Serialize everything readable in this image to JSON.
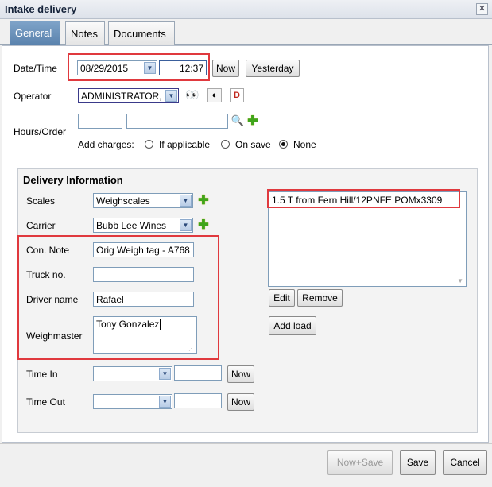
{
  "window": {
    "title": "Intake delivery"
  },
  "tabs": [
    {
      "label": "General"
    },
    {
      "label": "Notes"
    },
    {
      "label": "Documents"
    }
  ],
  "general": {
    "datetime_label": "Date/Time",
    "date_value": "08/29/2015",
    "time_value": "12:37",
    "now_label": "Now",
    "yesterday_label": "Yesterday",
    "operator_label": "Operator",
    "operator_value": "ADMINISTRATOR,",
    "hours_order_label": "Hours/Order",
    "add_charges_label": "Add charges:",
    "charge_options": [
      {
        "label": "If applicable"
      },
      {
        "label": "On save"
      },
      {
        "label": "None"
      }
    ],
    "selected_charge": "None"
  },
  "delivery": {
    "title": "Delivery Information",
    "scales_label": "Scales",
    "scales_value": "Weighscales",
    "carrier_label": "Carrier",
    "carrier_value": "Bubb Lee Wines",
    "con_note_label": "Con. Note",
    "con_note_value": "Orig Weigh tag - A768",
    "truck_label": "Truck no.",
    "truck_value": "",
    "driver_label": "Driver name",
    "driver_value": "Rafael",
    "weighmaster_label": "Weighmaster",
    "weighmaster_value": "Tony Gonzalez",
    "time_in_label": "Time In",
    "time_out_label": "Time Out",
    "now_label": "Now",
    "loads": [
      "1.5 T from Fern Hill/12PNFE POMx3309"
    ],
    "edit_label": "Edit",
    "remove_label": "Remove",
    "add_load_label": "Add load"
  },
  "footer": {
    "now_save_label": "Now+Save",
    "save_label": "Save",
    "cancel_label": "Cancel"
  },
  "colors": {
    "highlight": "#e0393e",
    "active_tab": "#6a91bb",
    "add_icon": "#3fa51b"
  }
}
